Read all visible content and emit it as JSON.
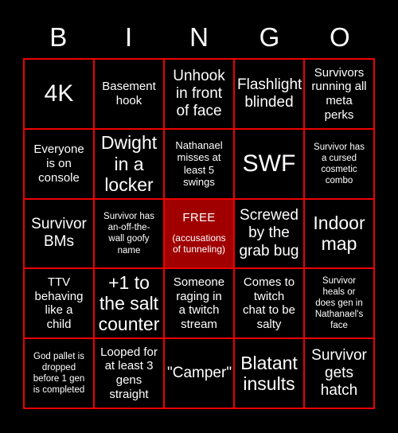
{
  "card": {
    "background_color": "#000000",
    "grid_line_color": "#ee0000",
    "text_color": "#ffffff",
    "free_cell_color": "#a00000"
  },
  "header": {
    "letters": [
      "B",
      "I",
      "N",
      "G",
      "O"
    ]
  },
  "grid": {
    "rows": 5,
    "columns": 5,
    "cells": [
      {
        "text": "4K",
        "size": "xxl",
        "free": false
      },
      {
        "text": "Basement\nhook",
        "size": "md",
        "free": false
      },
      {
        "text": "Unhook\nin front\nof face",
        "size": "lg",
        "free": false
      },
      {
        "text": "Flashlight\nblinded",
        "size": "lg",
        "free": false
      },
      {
        "text": "Survivors\nrunning all\nmeta\nperks",
        "size": "md",
        "free": false
      },
      {
        "text": "Everyone\nis on\nconsole",
        "size": "md",
        "free": false
      },
      {
        "text": "Dwight\nin a\nlocker",
        "size": "xl",
        "free": false
      },
      {
        "text": "Nathanael\nmisses at\nleast 5\nswings",
        "size": "sm",
        "free": false
      },
      {
        "text": "SWF",
        "size": "xxl",
        "free": false
      },
      {
        "text": "Survivor has\na cursed\ncosmetic\ncombo",
        "size": "xs",
        "free": false
      },
      {
        "text": "Survivor\nBMs",
        "size": "lg",
        "free": false
      },
      {
        "text": "Survivor has\nan-off-the-\nwall goofy\nname",
        "size": "xs",
        "free": false
      },
      {
        "text": "FREE",
        "subtext": "(accusations\nof tunneling)",
        "size": "md",
        "free": true
      },
      {
        "text": "Screwed\nby the\ngrab bug",
        "size": "lg",
        "free": false
      },
      {
        "text": "Indoor\nmap",
        "size": "xl",
        "free": false
      },
      {
        "text": "TTV\nbehaving\nlike a\nchild",
        "size": "md",
        "free": false
      },
      {
        "text": "+1 to\nthe salt\ncounter",
        "size": "xl",
        "free": false
      },
      {
        "text": "Someone\nraging in\na twitch\nstream",
        "size": "md",
        "free": false
      },
      {
        "text": "Comes to\ntwitch\nchat to be\nsalty",
        "size": "md",
        "free": false
      },
      {
        "text": "Survivor\nheals or\ndoes gen in\nNathanael's\nface",
        "size": "xs",
        "free": false
      },
      {
        "text": "God pallet is\ndropped\nbefore 1 gen\nis completed",
        "size": "xs",
        "free": false
      },
      {
        "text": "Looped for\nat least 3\ngens\nstraight",
        "size": "md",
        "free": false
      },
      {
        "text": "\"Camper\"",
        "size": "lg",
        "free": false
      },
      {
        "text": "Blatant\ninsults",
        "size": "xl",
        "free": false
      },
      {
        "text": "Survivor\ngets\nhatch",
        "size": "lg",
        "free": false
      }
    ]
  }
}
